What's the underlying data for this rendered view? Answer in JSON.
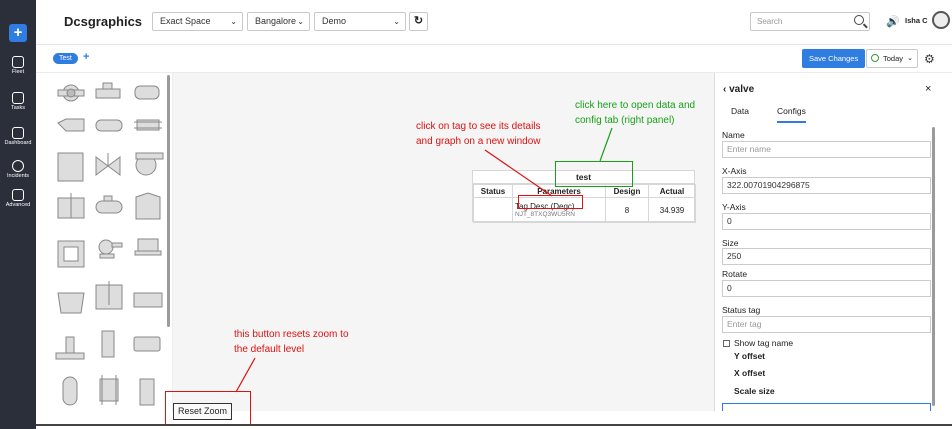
{
  "app": {
    "brand": "Dcsgraphics"
  },
  "rail": {
    "add": "+",
    "items": [
      {
        "label": "Fleet",
        "icon": "fleet-icon"
      },
      {
        "label": "Tasks",
        "icon": "tasks-icon"
      },
      {
        "label": "Dashboard",
        "icon": "dashboard-icon"
      },
      {
        "label": "Incidents",
        "icon": "incidents-icon"
      },
      {
        "label": "Advanced",
        "icon": "advanced-icon"
      }
    ]
  },
  "header": {
    "space_select": "Exact Space",
    "city_select": "Bangalore",
    "mode_select": "Demo",
    "search_placeholder": "Search",
    "user_name": "Isha C"
  },
  "toolbar": {
    "tab_label": "Test",
    "add_tab": "+",
    "save_label": "Save Changes",
    "range_label": "Today"
  },
  "canvas": {
    "widget_title": "test",
    "table": {
      "headers": [
        "Status",
        "Parameters",
        "Design",
        "Actual"
      ],
      "row": {
        "status": "",
        "tag_name": "Tag Desc (Degc)",
        "tag_code": "NJT_8TXQ3WU5RN",
        "design": "8",
        "actual": "34.939"
      }
    },
    "reset_label": "Reset Zoom"
  },
  "annotations": {
    "tag_note": [
      "click on tag to see its details",
      "and graph on a new window"
    ],
    "panel_note": [
      "click here to open data and",
      "config tab  (right panel)"
    ],
    "zoom_note": [
      "this button resets zoom to",
      "the default level"
    ]
  },
  "panel": {
    "title": "valve",
    "tabs": [
      "Data",
      "Configs"
    ],
    "active_tab": "Configs",
    "fields": {
      "name_label": "Name",
      "name_placeholder": "Enter name",
      "xaxis_label": "X-Axis",
      "xaxis_value": "322.00701904296875",
      "yaxis_label": "Y-Axis",
      "yaxis_value": "0",
      "size_label": "Size",
      "size_value": "250",
      "rotate_label": "Rotate",
      "rotate_value": "0",
      "status_label": "Status tag",
      "status_placeholder": "Enter tag",
      "show_tag_label": "Show tag name",
      "y_offset_label": "Y offset",
      "x_offset_label": "X offset",
      "scale_label": "Scale size"
    }
  },
  "colors": {
    "accent": "#2f7de1",
    "annotation_red": "#dd1111",
    "annotation_green": "#18a018",
    "rail": "#2a2f3a"
  }
}
